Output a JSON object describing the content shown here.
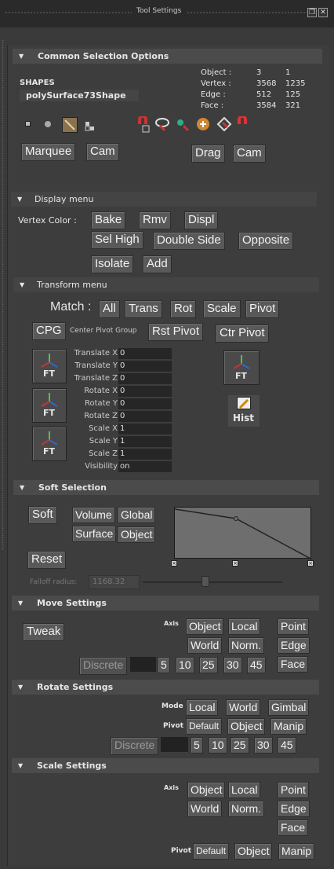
{
  "window": {
    "title": "Tool Settings"
  },
  "common": {
    "header": "Common Selection Options",
    "shapes_label": "SHAPES",
    "shape_name": "polySurface73Shape",
    "stats": [
      {
        "label": "Object :",
        "a": "3",
        "b": "1"
      },
      {
        "label": "Vertex :",
        "a": "3568",
        "b": "1235"
      },
      {
        "label": "Edge :",
        "a": "512",
        "b": "125"
      },
      {
        "label": "Face :",
        "a": "3584",
        "b": "321"
      }
    ],
    "buttons": {
      "marquee": "Marquee",
      "cam1": "Cam",
      "drag": "Drag",
      "cam2": "Cam"
    }
  },
  "display": {
    "header": "Display menu",
    "vertex_color_label": "Vertex Color :",
    "buttons": {
      "bake": "Bake",
      "rmv": "Rmv",
      "displ": "Displ",
      "sel_high": "Sel High",
      "double_side": "Double Side",
      "opposite": "Opposite",
      "isolate": "Isolate",
      "add": "Add"
    }
  },
  "transform": {
    "header": "Transform menu",
    "match_label": "Match :",
    "match_buttons": {
      "all": "All",
      "trans": "Trans",
      "rot": "Rot",
      "scale": "Scale",
      "pivot": "Pivot"
    },
    "cpg": "CPG",
    "cpg_desc": "Center Pivot Group",
    "rst_pivot": "Rst Pivot",
    "ctr_pivot": "Ctr Pivot",
    "ft_label": "FT",
    "hist_label": "Hist",
    "attrs": [
      {
        "label": "Translate X",
        "value": "0"
      },
      {
        "label": "Translate Y",
        "value": "0"
      },
      {
        "label": "Translate Z",
        "value": "0"
      },
      {
        "label": "Rotate X",
        "value": "0"
      },
      {
        "label": "Rotate Y",
        "value": "0"
      },
      {
        "label": "Rotate Z",
        "value": "0"
      },
      {
        "label": "Scale X",
        "value": "1"
      },
      {
        "label": "Scale Y",
        "value": "1"
      },
      {
        "label": "Scale Z",
        "value": "1"
      },
      {
        "label": "Visibility",
        "value": "on"
      }
    ]
  },
  "soft": {
    "header": "Soft Selection",
    "buttons": {
      "soft": "Soft",
      "volume": "Volume",
      "global": "Global",
      "surface": "Surface",
      "object": "Object",
      "reset": "Reset"
    },
    "falloff_label": "Falloff radius:",
    "falloff_value": "1168.32",
    "falloff_slider_fraction": 0.45
  },
  "move": {
    "header": "Move Settings",
    "tweak": "Tweak",
    "axis_label": "Axis",
    "buttons": {
      "object": "Object",
      "local": "Local",
      "point": "Point",
      "world": "World",
      "norm": "Norm.",
      "edge": "Edge",
      "discrete": "Discrete",
      "face": "Face"
    },
    "steps": [
      "5",
      "10",
      "25",
      "30",
      "45"
    ]
  },
  "rotate": {
    "header": "Rotate Settings",
    "mode_label": "Mode",
    "pivot_label": "Pivot",
    "buttons": {
      "local": "Local",
      "world": "World",
      "gimbal": "Gimbal",
      "default": "Default",
      "object": "Object",
      "manip": "Manip",
      "discrete": "Discrete"
    },
    "steps": [
      "5",
      "10",
      "25",
      "30",
      "45"
    ]
  },
  "scale": {
    "header": "Scale Settings",
    "axis_label": "Axis",
    "pivot_label": "Pivot",
    "buttons": {
      "object": "Object",
      "local": "Local",
      "point": "Point",
      "world": "World",
      "norm": "Norm.",
      "edge": "Edge",
      "face": "Face",
      "default": "Default",
      "object2": "Object",
      "manip": "Manip"
    }
  },
  "colors": {
    "bg": "#3a3a3a",
    "frame": "#4b4b4b",
    "button": "#595959",
    "graph": "#6e6e6e"
  }
}
